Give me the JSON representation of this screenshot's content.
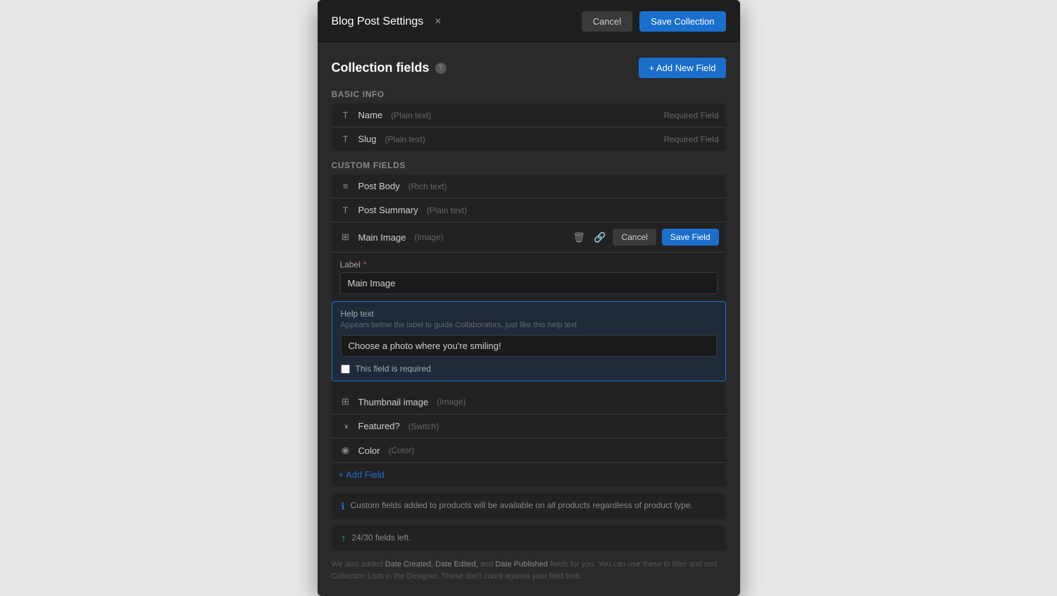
{
  "modal": {
    "title": "Blog Post Settings",
    "close_label": "×",
    "cancel_label": "Cancel",
    "save_collection_label": "Save Collection"
  },
  "collection_fields": {
    "title": "Collection fields",
    "help_icon": "?",
    "add_field_label": "+ Add New Field"
  },
  "basic_info": {
    "label": "Basic info",
    "fields": [
      {
        "icon": "T",
        "name": "Name",
        "type": "(Plain text)",
        "required": "Required Field"
      },
      {
        "icon": "T",
        "name": "Slug",
        "type": "(Plain text)",
        "required": "Required Field"
      }
    ]
  },
  "custom_fields": {
    "label": "Custom fields",
    "fields": [
      {
        "icon": "≡",
        "name": "Post Body",
        "type": "(Rich text)",
        "required": ""
      },
      {
        "icon": "T",
        "name": "Post Summary",
        "type": "(Plain text)",
        "required": ""
      }
    ]
  },
  "main_image_field": {
    "icon": "⊞",
    "name": "Main Image",
    "type": "(Image)",
    "cancel_label": "Cancel",
    "save_label": "Save Field",
    "label_text": "Label",
    "label_value": "Main Image",
    "help_text_title": "Help text",
    "help_text_desc": "Appears below the label to guide Collaborators, just like this help text",
    "help_text_placeholder": "Choose a photo where you're smiling!",
    "required_checkbox_label": "This field is required"
  },
  "remaining_fields": [
    {
      "icon": "⊞",
      "name": "Thumbnail image",
      "type": "(Image)"
    },
    {
      "icon": "◑",
      "name": "Featured?",
      "type": "(Switch)"
    },
    {
      "icon": "◉",
      "name": "Color",
      "type": "(Color)"
    }
  ],
  "add_field_label": "+ Add Field",
  "info_bar": {
    "text": "Custom fields added to products will be available on all products regardless of product type."
  },
  "fields_left": {
    "count": "24/30 fields left."
  },
  "footer_note": "We also added Date Created, Date Edited, and Date Published fields for you. You can use these to filter and sort Collection Lists in the Designer. These don't count against your field limit."
}
